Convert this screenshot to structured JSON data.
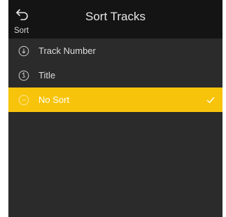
{
  "header": {
    "back_label": "Sort",
    "title": "Sort Tracks",
    "back_icon": "back-arrow-icon"
  },
  "options": [
    {
      "label": "Track Number",
      "icon": "sort-number-icon",
      "selected": false
    },
    {
      "label": "Title",
      "icon": "sort-title-icon",
      "selected": false
    },
    {
      "label": "No Sort",
      "icon": "no-sort-icon",
      "selected": true
    }
  ],
  "colors": {
    "background": "#2b2b2b",
    "header": "#141414",
    "selected": "#f8c40b",
    "text": "#dcdcdc"
  }
}
